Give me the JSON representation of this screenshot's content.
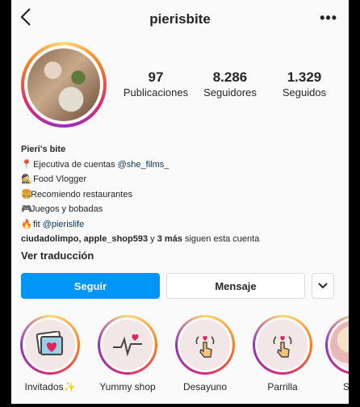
{
  "header": {
    "username": "pierisbite",
    "more_label": "•••"
  },
  "stats": [
    {
      "value": "97",
      "label": "Publicaciones"
    },
    {
      "value": "8.286",
      "label": "Seguidores"
    },
    {
      "value": "1.329",
      "label": "Seguidos"
    }
  ],
  "bio": {
    "name": "Pieri's bite",
    "line1_text": "Ejecutiva de cuentas ",
    "line1_mention": "@she_films_",
    "line2": "Food Vlogger",
    "line3": "Recomiendo restaurantes",
    "line4": "Juegos y bobadas",
    "line5_text": "fit ",
    "line5_mention": "@pierislife",
    "followed_names": "ciudadolimpo, apple_shop593",
    "followed_mid": " y ",
    "followed_more": "3 más",
    "followed_end": " siguen esta cuenta",
    "translate": "Ver traducción"
  },
  "actions": {
    "follow": "Seguir",
    "message": "Mensaje"
  },
  "highlights": [
    {
      "label": "Invitados✨",
      "icon": "photo-heart-icon"
    },
    {
      "label": "Yummy shop",
      "icon": "heartbeat-icon"
    },
    {
      "label": "Desayuno",
      "icon": "tap-hand-icon"
    },
    {
      "label": "Parrilla",
      "icon": "tap-hand-icon"
    },
    {
      "label": "Saluc",
      "icon": "food-photo"
    }
  ],
  "colors": {
    "accent": "#0095f6",
    "mention": "#00376b"
  }
}
